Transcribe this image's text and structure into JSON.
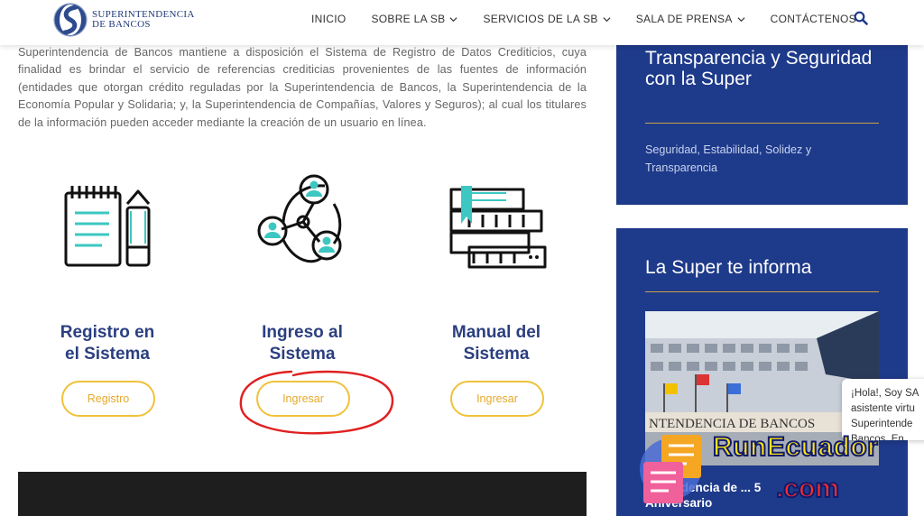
{
  "header": {
    "logo_line1": "SUPERINTENDENCIA",
    "logo_line2": "DE BANCOS",
    "nav": [
      {
        "label": "INICIO",
        "has_dropdown": false
      },
      {
        "label": "SOBRE LA SB",
        "has_dropdown": true
      },
      {
        "label": "SERVICIOS DE LA SB",
        "has_dropdown": true
      },
      {
        "label": "SALA DE PRENSA",
        "has_dropdown": true
      },
      {
        "label": "CONTÁCTENOS",
        "has_dropdown": false
      }
    ],
    "search_icon": "search-icon"
  },
  "main": {
    "intro": "Superintendencia de Bancos mantiene a disposición el Sistema de Registro de Datos Crediticios, cuya finalidad es brindar el servicio de referencias crediticias provenientes de las fuentes de información (entidades que otorgan crédito reguladas por la Superintendencia de Bancos, la Superintendencia de la Economía Popular y Solidaria; y, la Superintendencia de Compañías, Valores y Seguros); al cual los titulares de la información pueden acceder mediante la creación de un usuario en línea.",
    "cards": [
      {
        "title_line1": "Registro en",
        "title_line2": "el Sistema",
        "button": "Registro",
        "icon": "notepad-pencil-icon"
      },
      {
        "title_line1": "Ingreso al",
        "title_line2": "Sistema",
        "button": "Ingresar",
        "icon": "users-network-icon"
      },
      {
        "title_line1": "Manual del",
        "title_line2": "Sistema",
        "button": "Ingresar",
        "icon": "books-stack-icon"
      }
    ]
  },
  "sidebar": {
    "box1_title": "Transparencia y Seguridad con la Super",
    "box1_subtitle": "Seguridad, Estabilidad, Solidez y Transparencia",
    "box2_title": "La Super te informa",
    "box2_photo_sign": "NTENDENCIA DE BANCOS",
    "box2_caption_line1": "...ntendencia de ... 5",
    "box2_caption_line2": "Aniversario"
  },
  "chat": {
    "line1": "¡Hola!, Soy SA",
    "line2": "asistente virtu",
    "line3": "Superintende",
    "line4": "Bancos. En..."
  },
  "watermark": {
    "line1": "RunEcuador",
    "line2": ".com"
  },
  "colors": {
    "brand_blue": "#1e3a8a",
    "title_blue": "#2b3f80",
    "button_gold": "#f0c23a",
    "teal": "#3cc7c2",
    "annotation_red": "#e02020"
  }
}
